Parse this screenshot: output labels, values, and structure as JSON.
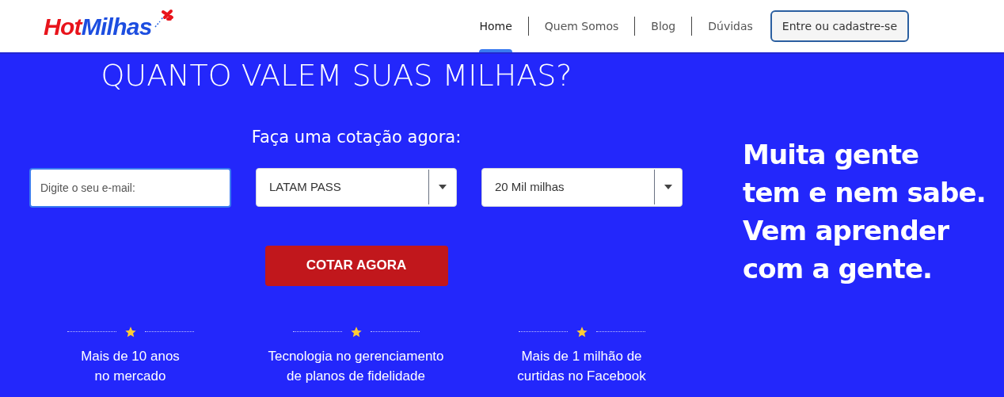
{
  "logo": {
    "hot": "Hot",
    "milhas": "Milhas"
  },
  "nav": [
    {
      "label": "Home",
      "selected": true
    },
    {
      "label": "Quem Somos",
      "selected": false
    },
    {
      "label": "Blog",
      "selected": false
    },
    {
      "label": "Dúvidas",
      "selected": false
    }
  ],
  "login_button": "Entre ou cadastre-se",
  "headline": "QUANTO VALEM SUAS MILHAS?",
  "form": {
    "title": "Faça uma cotação agora:",
    "email": {
      "placeholder": "Digite o seu e-mail:"
    },
    "program": "LATAM PASS",
    "miles": "20 Mil milhas",
    "submit": "COTAR AGORA"
  },
  "slogan": [
    "Muita gente",
    "tem e nem sabe.",
    "Vem aprender",
    "com a gente."
  ],
  "features": [
    {
      "lines": [
        "Mais de 10 anos",
        "no mercado"
      ]
    },
    {
      "lines": [
        "Tecnologia no gerenciamento",
        "de planos de fidelidade"
      ]
    },
    {
      "lines": [
        "Mais de 1 milhão de",
        "curtidas no Facebook"
      ]
    }
  ]
}
